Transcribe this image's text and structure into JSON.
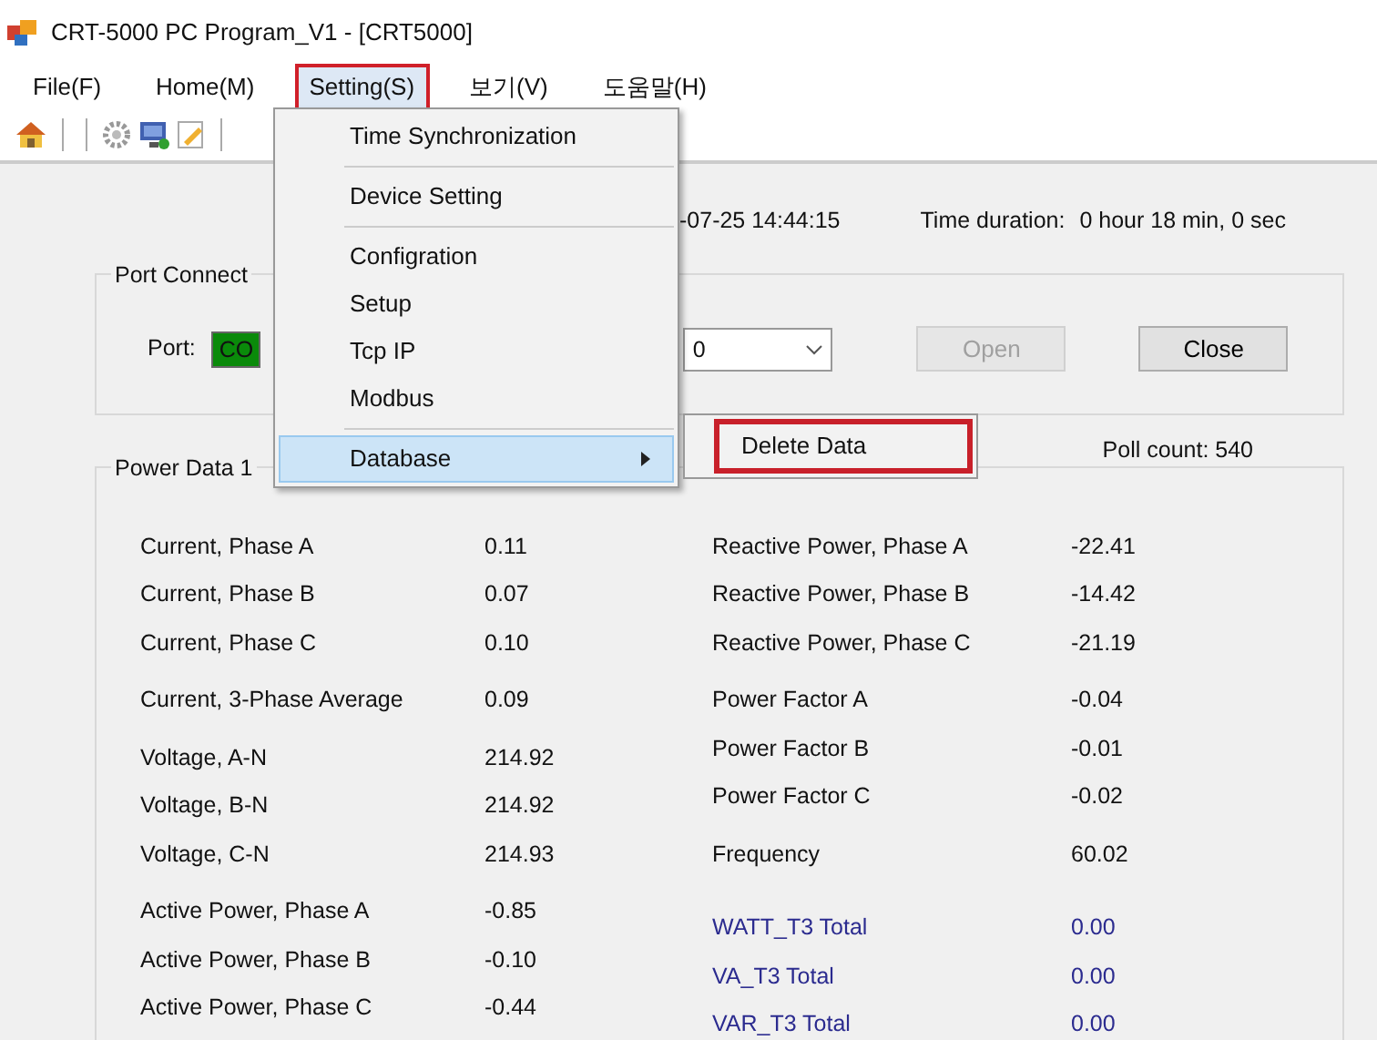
{
  "window": {
    "title": "CRT-5000 PC Program_V1 - [CRT5000]"
  },
  "menu": [
    {
      "label": "File(F)",
      "selected": false,
      "highlighted": false
    },
    {
      "label": "Home(M)",
      "selected": false,
      "highlighted": false
    },
    {
      "label": "Setting(S)",
      "selected": true,
      "highlighted": true
    },
    {
      "label": "보기(V)",
      "selected": false,
      "highlighted": false
    },
    {
      "label": "도움말(H)",
      "selected": false,
      "highlighted": false
    }
  ],
  "dropdown": {
    "groups": [
      [
        {
          "label": "Time Synchronization",
          "selected": false,
          "submenu": false
        }
      ],
      [
        {
          "label": "Device Setting",
          "selected": false,
          "submenu": false
        }
      ],
      [
        {
          "label": "Configration",
          "selected": false,
          "submenu": false
        },
        {
          "label": "Setup",
          "selected": false,
          "submenu": false
        },
        {
          "label": "Tcp IP",
          "selected": false,
          "submenu": false
        },
        {
          "label": "Modbus",
          "selected": false,
          "submenu": false
        }
      ],
      [
        {
          "label": "Database",
          "selected": true,
          "submenu": true
        }
      ]
    ],
    "submenu": [
      {
        "label": "Delete Data",
        "highlighted": true
      }
    ]
  },
  "info": {
    "date": "-07-25 14:44:15",
    "duration_label": "Time duration:",
    "duration": "0 hour 18 min, 0 sec"
  },
  "port_group": {
    "title": "Port Connect",
    "port_label": "Port:",
    "port_value": "CO",
    "baud_value": "0",
    "buttons": [
      {
        "label": "Open",
        "disabled": true
      },
      {
        "label": "Close",
        "disabled": false
      }
    ]
  },
  "poll_count": "Poll count: 540",
  "power_group": {
    "title": "Power Data 1",
    "left": [
      [
        {
          "label": "Current, Phase A",
          "value": "0.11",
          "kind": "plain"
        },
        {
          "label": "Current, Phase B",
          "value": "0.07",
          "kind": "plain"
        },
        {
          "label": "Current, Phase C",
          "value": "0.10",
          "kind": "plain"
        }
      ],
      [
        {
          "label": "Current, 3-Phase Average",
          "value": "0.09",
          "kind": "plain"
        }
      ],
      [
        {
          "label": "Voltage, A-N",
          "value": "214.92",
          "kind": "plain"
        },
        {
          "label": "Voltage, B-N",
          "value": "214.92",
          "kind": "plain"
        },
        {
          "label": "Voltage, C-N",
          "value": "214.93",
          "kind": "plain"
        }
      ],
      [
        {
          "label": "Active Power, Phase A",
          "value": "-0.85",
          "kind": "plain"
        },
        {
          "label": "Active Power, Phase B",
          "value": "-0.10",
          "kind": "plain"
        },
        {
          "label": "Active Power, Phase C",
          "value": "-0.44",
          "kind": "plain"
        }
      ]
    ],
    "right": [
      [
        {
          "label": "Reactive Power, Phase A",
          "value": "-22.41",
          "kind": "plain"
        },
        {
          "label": "Reactive Power, Phase B",
          "value": "-14.42",
          "kind": "plain"
        },
        {
          "label": "Reactive Power, Phase C",
          "value": "-21.19",
          "kind": "plain"
        }
      ],
      [
        {
          "label": "Power Factor A",
          "value": "-0.04",
          "kind": "plain"
        },
        {
          "label": "Power Factor B",
          "value": "-0.01",
          "kind": "plain"
        },
        {
          "label": "Power Factor C",
          "value": "-0.02",
          "kind": "plain"
        }
      ],
      [
        {
          "label": "Frequency",
          "value": "60.02",
          "kind": "plain"
        }
      ],
      [
        {
          "label": "WATT_T3 Total",
          "value": "0.00",
          "kind": "total"
        },
        {
          "label": "VA_T3 Total",
          "value": "0.00",
          "kind": "total"
        },
        {
          "label": "VAR_T3 Total",
          "value": "0.00",
          "kind": "total"
        }
      ]
    ]
  }
}
